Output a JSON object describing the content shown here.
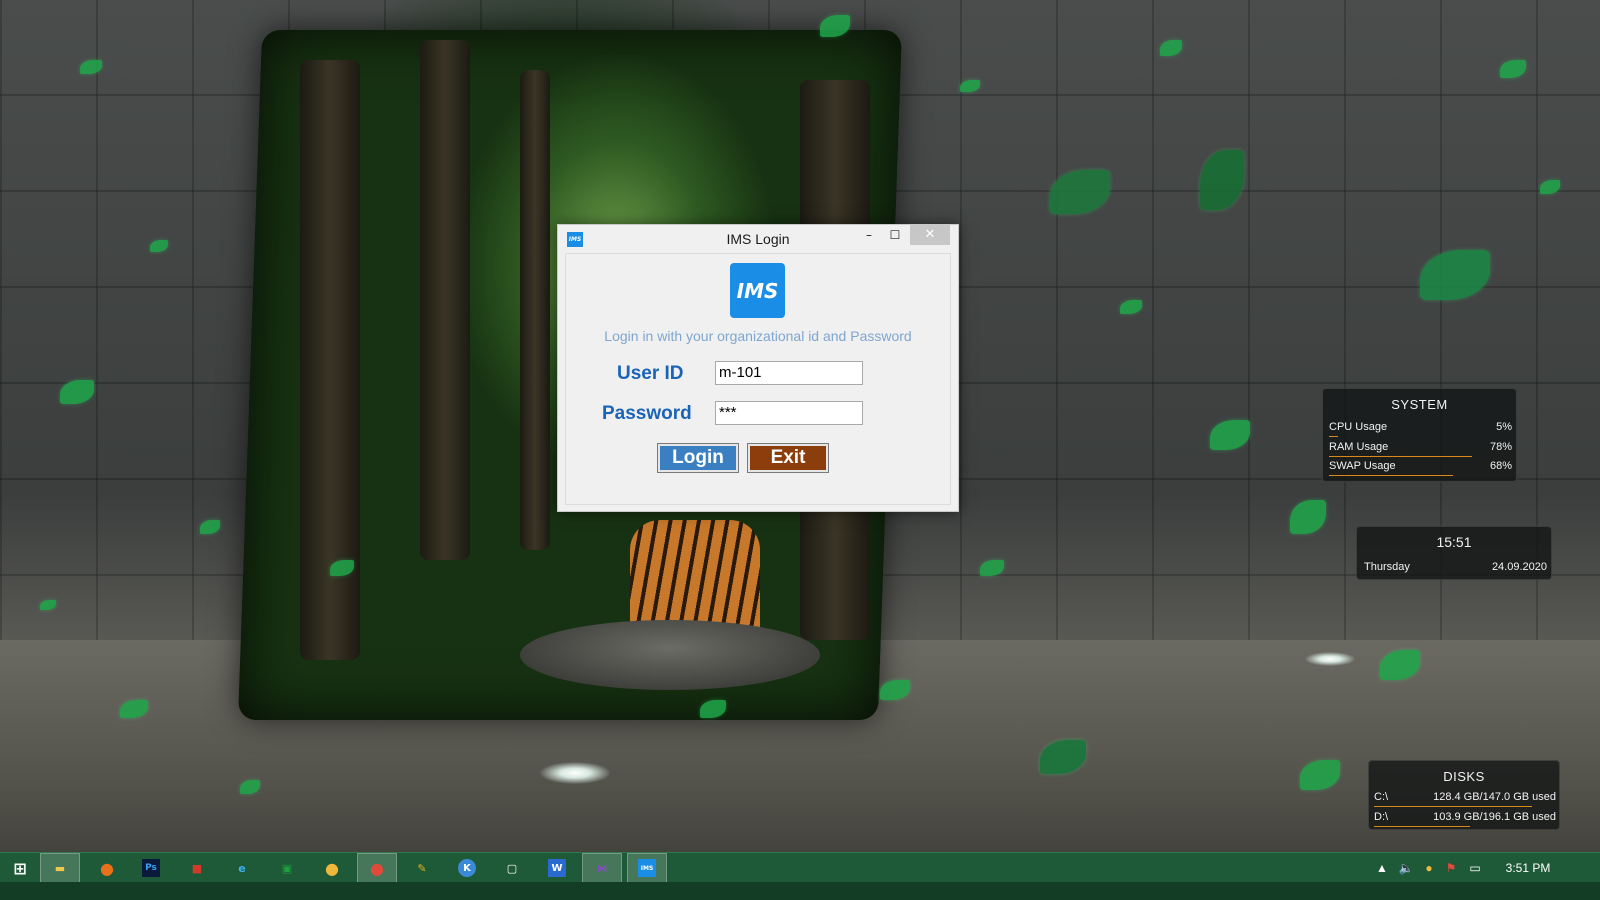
{
  "window": {
    "title": "IMS  Login",
    "app_icon_text": "IMS",
    "minimize": "–",
    "maximize": "☐",
    "close": "✕"
  },
  "login": {
    "logo_text": "IMS",
    "subtitle": "Login in with your organizational id  and Password",
    "user_label": "User ID",
    "user_value": "m-101",
    "password_label": "Password",
    "password_value": "***",
    "login_button": "Login",
    "exit_button": "Exit"
  },
  "system_gadget": {
    "title": "SYSTEM",
    "rows": [
      {
        "label": "CPU Usage",
        "value": "5%",
        "level": 0.05
      },
      {
        "label": "RAM Usage",
        "value": "78%",
        "level": 0.78
      },
      {
        "label": "SWAP Usage",
        "value": "68%",
        "level": 0.68
      }
    ]
  },
  "clock_gadget": {
    "time": "15:51",
    "day": "Thursday",
    "date": "24.09.2020"
  },
  "disks_gadget": {
    "title": "DISKS",
    "rows": [
      {
        "label": "C:\\",
        "value": "128.4 GB/147.0 GB used",
        "level": 0.87
      },
      {
        "label": "D:\\",
        "value": "103.9 GB/196.1 GB used",
        "level": 0.53
      }
    ]
  },
  "taskbar": {
    "items": [
      {
        "name": "start-icon",
        "glyph": "⊞",
        "color": "#ffffff"
      },
      {
        "name": "file-explorer-icon",
        "glyph": "▬",
        "color": "#f2c84b"
      },
      {
        "name": "firefox-icon",
        "glyph": "●",
        "color": "#e8701a"
      },
      {
        "name": "photoshop-icon",
        "glyph": "Ps",
        "color": "#2a3e8c"
      },
      {
        "name": "colors-app-icon",
        "glyph": "■",
        "color": "#d43a2a"
      },
      {
        "name": "internet-explorer-icon",
        "glyph": "e",
        "color": "#3ab0f0"
      },
      {
        "name": "excel-icon",
        "glyph": "▣",
        "color": "#1e9e3e"
      },
      {
        "name": "chrome-canary-icon",
        "glyph": "●",
        "color": "#f0b83a"
      },
      {
        "name": "chrome-icon",
        "glyph": "●",
        "color": "#e04a3a"
      },
      {
        "name": "paint-icon",
        "glyph": "✎",
        "color": "#e0b020"
      },
      {
        "name": "k-app-icon",
        "glyph": "K",
        "color": "#3a8ad8"
      },
      {
        "name": "window-app-icon",
        "glyph": "▢",
        "color": "#ffffff"
      },
      {
        "name": "word-icon",
        "glyph": "W",
        "color": "#2a6ad0"
      },
      {
        "name": "visual-studio-icon",
        "glyph": "⋈",
        "color": "#8a4ac8"
      },
      {
        "name": "ims-app-icon",
        "glyph": "IMS",
        "color": "#1a8ee6"
      }
    ],
    "tray": {
      "overflow": "▲",
      "volume": "🔈",
      "browser": "●",
      "flag": "⚑",
      "network": "▭",
      "clock": "3:51 PM"
    }
  }
}
